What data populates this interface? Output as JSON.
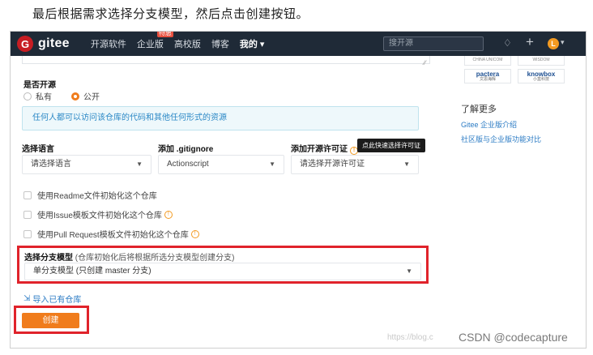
{
  "caption": "最后根据需求选择分支模型，然后点击创建按钮。",
  "nav": {
    "logo_letter": "G",
    "logo_text": "gitee",
    "items": [
      "开源软件",
      "企业版",
      "高校版",
      "博客",
      "我的 ▾"
    ],
    "hot_badge": "特惠",
    "search_placeholder": "搜开源",
    "avatar_letter": "L",
    "brand_color": "#c71d23"
  },
  "form": {
    "open_source_label": "是否开源",
    "visibility_options": [
      "私有",
      "公开"
    ],
    "visibility_selected": "公开",
    "info_text": "任何人都可以访问该仓库的代码和其他任何形式的资源",
    "language_label": "选择语言",
    "language_value": "请选择语言",
    "gitignore_label": "添加 .gitignore",
    "gitignore_value": "Actionscript",
    "license_label": "添加开源许可证",
    "license_value": "请选择开源许可证",
    "license_tooltip": "点此快速选择许可证",
    "init_readme": "使用Readme文件初始化这个仓库",
    "init_issue": "使用Issue模板文件初始化这个仓库",
    "init_pr": "使用Pull Request模板文件初始化这个仓库",
    "branch_label": "选择分支模型",
    "branch_hint": "(仓库初始化后将根据所选分支模型创建分支)",
    "branch_value": "单分支模型 (只创建 master 分支)",
    "import_link": "导入已有仓库",
    "create_button": "创建",
    "accent_color": "#f07c1c",
    "highlight_color": "#e0232b"
  },
  "sidebar": {
    "partner_captions": [
      "CHINA UNICOM",
      "WISDOM"
    ],
    "partners": [
      {
        "name": "pactera",
        "sub": "文思海辉"
      },
      {
        "name": "knowbox",
        "sub": "小盒科技"
      }
    ],
    "learn_more": "了解更多",
    "links": [
      "Gitee 企业版介绍",
      "社区版与企业版功能对比"
    ]
  },
  "watermark": "https://blog.c",
  "csdn_mark": "CSDN @codecapture"
}
